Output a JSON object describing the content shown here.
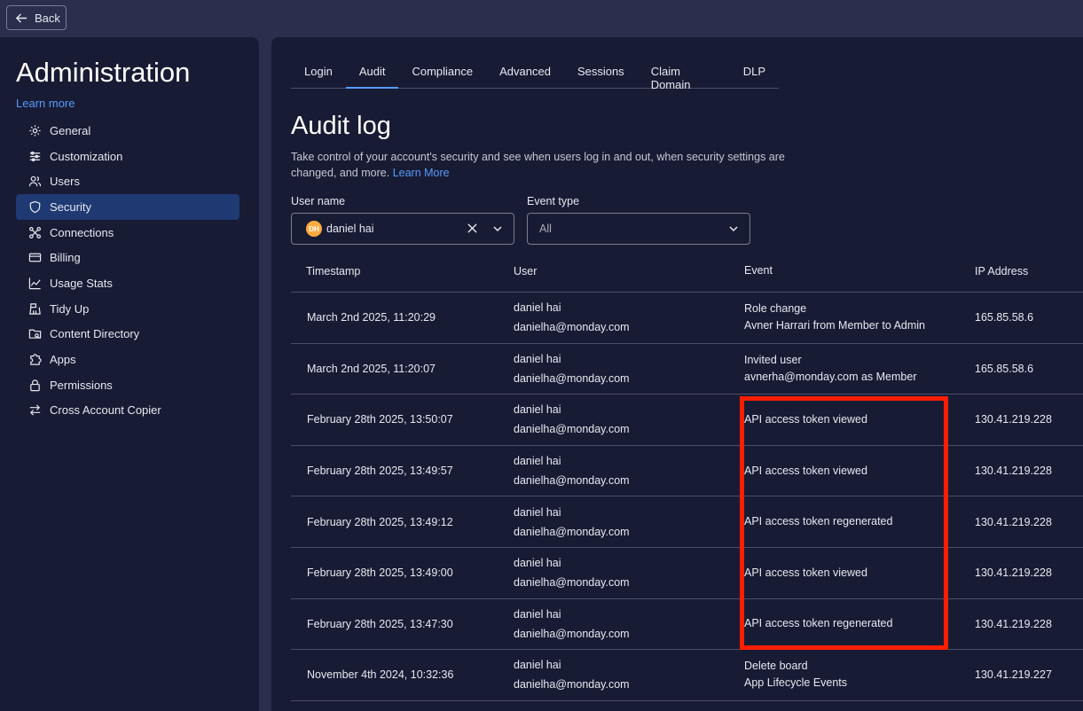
{
  "topbar": {
    "back_label": "Back"
  },
  "sidebar": {
    "title": "Administration",
    "learn_more": "Learn more",
    "items": [
      {
        "label": "General",
        "icon": "gear-icon"
      },
      {
        "label": "Customization",
        "icon": "sliders-icon"
      },
      {
        "label": "Users",
        "icon": "users-icon"
      },
      {
        "label": "Security",
        "icon": "shield-icon"
      },
      {
        "label": "Connections",
        "icon": "connections-icon"
      },
      {
        "label": "Billing",
        "icon": "credit-card-icon"
      },
      {
        "label": "Usage Stats",
        "icon": "chart-line-icon"
      },
      {
        "label": "Tidy Up",
        "icon": "broom-icon"
      },
      {
        "label": "Content Directory",
        "icon": "folder-search-icon"
      },
      {
        "label": "Apps",
        "icon": "puzzle-icon"
      },
      {
        "label": "Permissions",
        "icon": "lock-icon"
      },
      {
        "label": "Cross Account Copier",
        "icon": "swap-arrows-icon"
      }
    ],
    "active_item": "Security"
  },
  "tabs": [
    "Login",
    "Audit",
    "Compliance",
    "Advanced",
    "Sessions",
    "Claim Domain",
    "DLP"
  ],
  "active_tab": "Audit",
  "main": {
    "title": "Audit log",
    "description": "Take control of your account's security and see when users log in and out, when security settings are changed, and more.",
    "description_link": "Learn More"
  },
  "filters": {
    "user_name_label": "User name",
    "user_name_value": "daniel hai",
    "user_avatar_initials": "DH",
    "event_type_label": "Event type",
    "event_type_value": "All"
  },
  "table": {
    "headers": {
      "timestamp": "Timestamp",
      "user": "User",
      "event": "Event",
      "ip": "IP Address"
    },
    "rows": [
      {
        "timestamp": "March 2nd 2025, 11:20:29",
        "user_name": "daniel hai",
        "user_email": "danielha@monday.com",
        "event": "Role change",
        "event_detail": "Avner Harrari from Member to Admin",
        "ip": "165.85.58.6"
      },
      {
        "timestamp": "March 2nd 2025, 11:20:07",
        "user_name": "daniel hai",
        "user_email": "danielha@monday.com",
        "event": "Invited user",
        "event_detail": "avnerha@monday.com as Member",
        "ip": "165.85.58.6"
      },
      {
        "timestamp": "February 28th 2025, 13:50:07",
        "user_name": "daniel hai",
        "user_email": "danielha@monday.com",
        "event": "API access token viewed",
        "event_detail": "",
        "ip": "130.41.219.228"
      },
      {
        "timestamp": "February 28th 2025, 13:49:57",
        "user_name": "daniel hai",
        "user_email": "danielha@monday.com",
        "event": "API access token viewed",
        "event_detail": "",
        "ip": "130.41.219.228"
      },
      {
        "timestamp": "February 28th 2025, 13:49:12",
        "user_name": "daniel hai",
        "user_email": "danielha@monday.com",
        "event": "API access token regenerated",
        "event_detail": "",
        "ip": "130.41.219.228"
      },
      {
        "timestamp": "February 28th 2025, 13:49:00",
        "user_name": "daniel hai",
        "user_email": "danielha@monday.com",
        "event": "API access token viewed",
        "event_detail": "",
        "ip": "130.41.219.228"
      },
      {
        "timestamp": "February 28th 2025, 13:47:30",
        "user_name": "daniel hai",
        "user_email": "danielha@monday.com",
        "event": "API access token regenerated",
        "event_detail": "",
        "ip": "130.41.219.228"
      },
      {
        "timestamp": "November 4th 2024, 10:32:36",
        "user_name": "daniel hai",
        "user_email": "danielha@monday.com",
        "event": "Delete board",
        "event_detail": "App Lifecycle Events",
        "ip": "130.41.219.227"
      }
    ]
  },
  "highlight_color": "#ff1f00"
}
